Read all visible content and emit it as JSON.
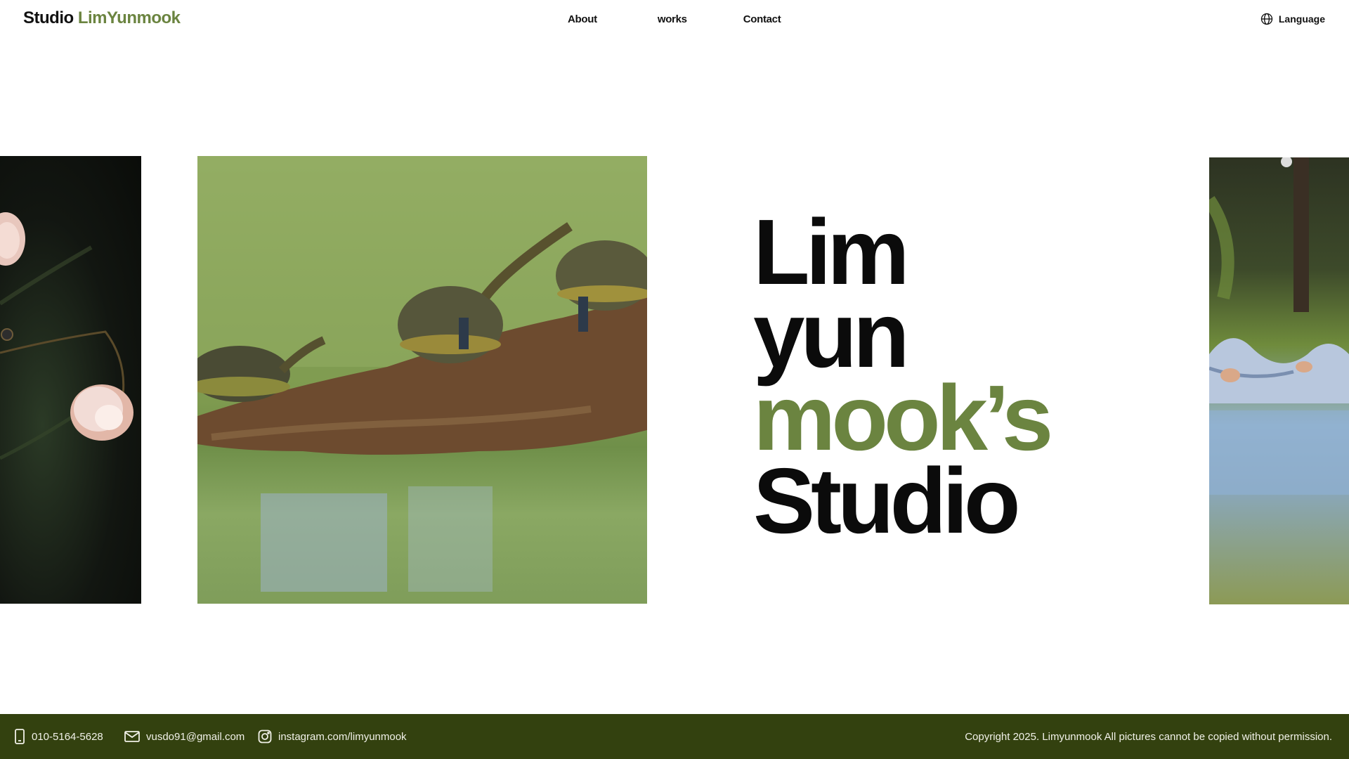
{
  "header": {
    "logo_studio": "Studio",
    "logo_name": "LimYunmook",
    "nav": {
      "about": "About",
      "works": "works",
      "contact": "Contact"
    },
    "language": "Language",
    "language_icon": "globe-icon"
  },
  "hero": {
    "line1": "Lim",
    "line2": "yun",
    "line3": "mook’s",
    "line4": "Studio",
    "accent_color": "#6b8440"
  },
  "gallery": {
    "items": [
      {
        "subject": "white flowers on dark background"
      },
      {
        "subject": "turtles on a log in green water"
      },
      {
        "subject": "swan boat on a lake"
      }
    ]
  },
  "footer": {
    "background_color": "#33410f",
    "phone_icon": "phone-icon",
    "phone": "010-5164-5628",
    "email_icon": "mail-icon",
    "email": "vusdo91@gmail.com",
    "instagram_icon": "instagram-icon",
    "instagram": "instagram.com/limyunmook",
    "copyright": "Copyright 2025. Limyunmook All pictures cannot be copied without permission."
  }
}
